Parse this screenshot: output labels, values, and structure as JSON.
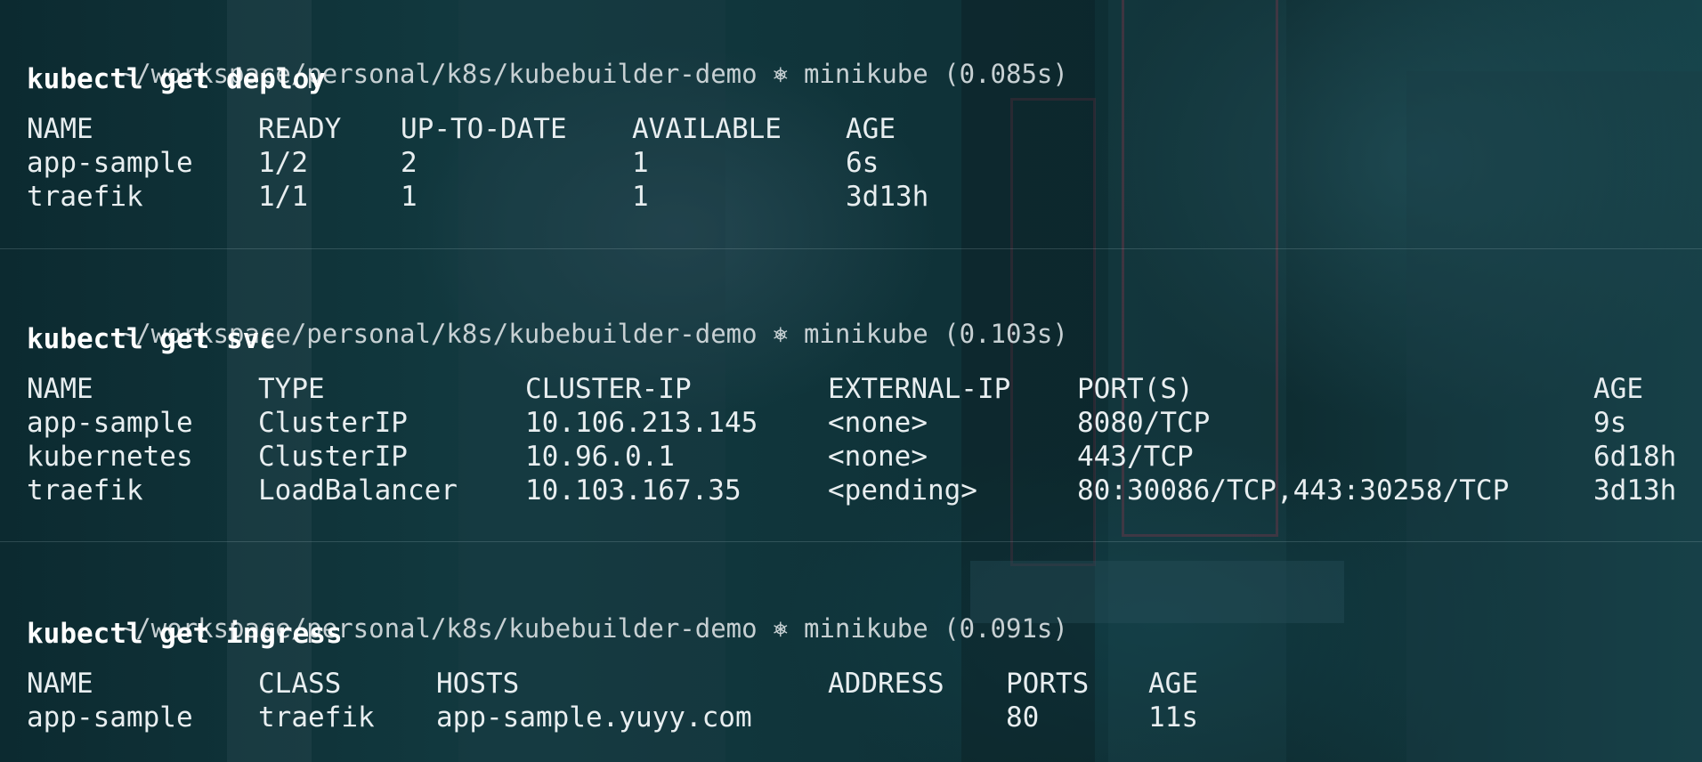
{
  "blocks": [
    {
      "prompt": {
        "path": "~/workspace/personal/k8s/kubebuilder-demo",
        "symbol": "⎈",
        "context": "minikube",
        "timing": "(0.085s)"
      },
      "command": "kubectl get deploy",
      "table": {
        "headers": [
          "NAME",
          "READY",
          "UP-TO-DATE",
          "AVAILABLE",
          "AGE"
        ],
        "rows": [
          [
            "app-sample",
            "1/2",
            "2",
            "1",
            "6s"
          ],
          [
            "traefik",
            "1/1",
            "1",
            "1",
            "3d13h"
          ]
        ]
      }
    },
    {
      "prompt": {
        "path": "~/workspace/personal/k8s/kubebuilder-demo",
        "symbol": "⎈",
        "context": "minikube",
        "timing": "(0.103s)"
      },
      "command": "kubectl get svc",
      "table": {
        "headers": [
          "NAME",
          "TYPE",
          "CLUSTER-IP",
          "EXTERNAL-IP",
          "PORT(S)",
          "AGE"
        ],
        "rows": [
          [
            "app-sample",
            "ClusterIP",
            "10.106.213.145",
            "<none>",
            "8080/TCP",
            "9s"
          ],
          [
            "kubernetes",
            "ClusterIP",
            "10.96.0.1",
            "<none>",
            "443/TCP",
            "6d18h"
          ],
          [
            "traefik",
            "LoadBalancer",
            "10.103.167.35",
            "<pending>",
            "80:30086/TCP,443:30258/TCP",
            "3d13h"
          ]
        ]
      }
    },
    {
      "prompt": {
        "path": "~/workspace/personal/k8s/kubebuilder-demo",
        "symbol": "⎈",
        "context": "minikube",
        "timing": "(0.091s)"
      },
      "command": "kubectl get ingress",
      "table": {
        "headers": [
          "NAME",
          "CLASS",
          "HOSTS",
          "ADDRESS",
          "PORTS",
          "AGE"
        ],
        "rows": [
          [
            "app-sample",
            "traefik",
            "app-sample.yuyy.com",
            "",
            "80",
            "11s"
          ]
        ]
      }
    }
  ],
  "colors": {
    "background": "#0f2f34",
    "text": "#e8eef0",
    "prompt": "#c7d0d3",
    "command": "#ffffff"
  }
}
